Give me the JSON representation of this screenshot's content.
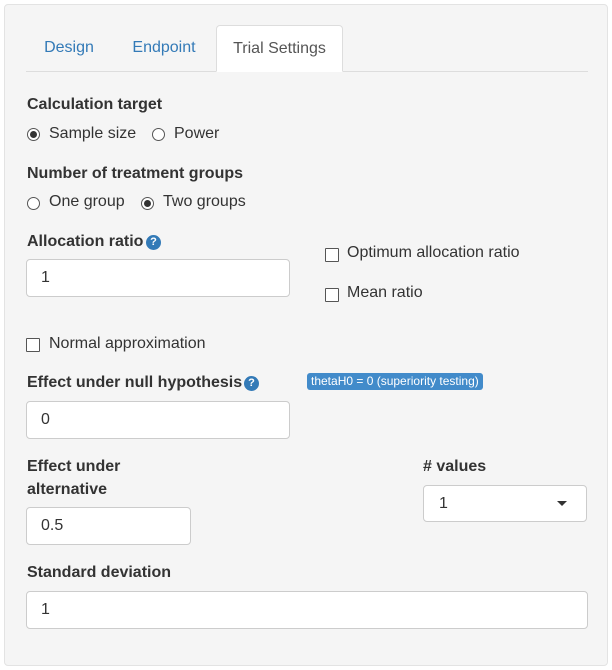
{
  "tabs": [
    "Design",
    "Endpoint",
    "Trial Settings"
  ],
  "calculation_target": {
    "label": "Calculation target",
    "options": [
      "Sample size",
      "Power"
    ],
    "selected": "Sample size"
  },
  "treatment_groups": {
    "label": "Number of treatment groups",
    "options": [
      "One group",
      "Two groups"
    ],
    "selected": "Two groups"
  },
  "allocation_ratio": {
    "label": "Allocation ratio",
    "value": "1",
    "optimum_label": "Optimum allocation ratio",
    "mean_ratio_label": "Mean ratio"
  },
  "normal_approximation": {
    "label": "Normal approximation"
  },
  "effect_null": {
    "label": "Effect under null hypothesis",
    "value": "0",
    "badge": "thetaH0 = 0 (superiority testing)"
  },
  "effect_alternative": {
    "label_line1": "Effect under",
    "label_line2": "alternative",
    "value": "0.5"
  },
  "num_values": {
    "label": "# values",
    "selected": "1"
  },
  "standard_deviation": {
    "label": "Standard deviation",
    "value": "1"
  },
  "colors": {
    "accent": "#337ab7",
    "badge": "#428bca",
    "panel": "#f5f5f5"
  }
}
